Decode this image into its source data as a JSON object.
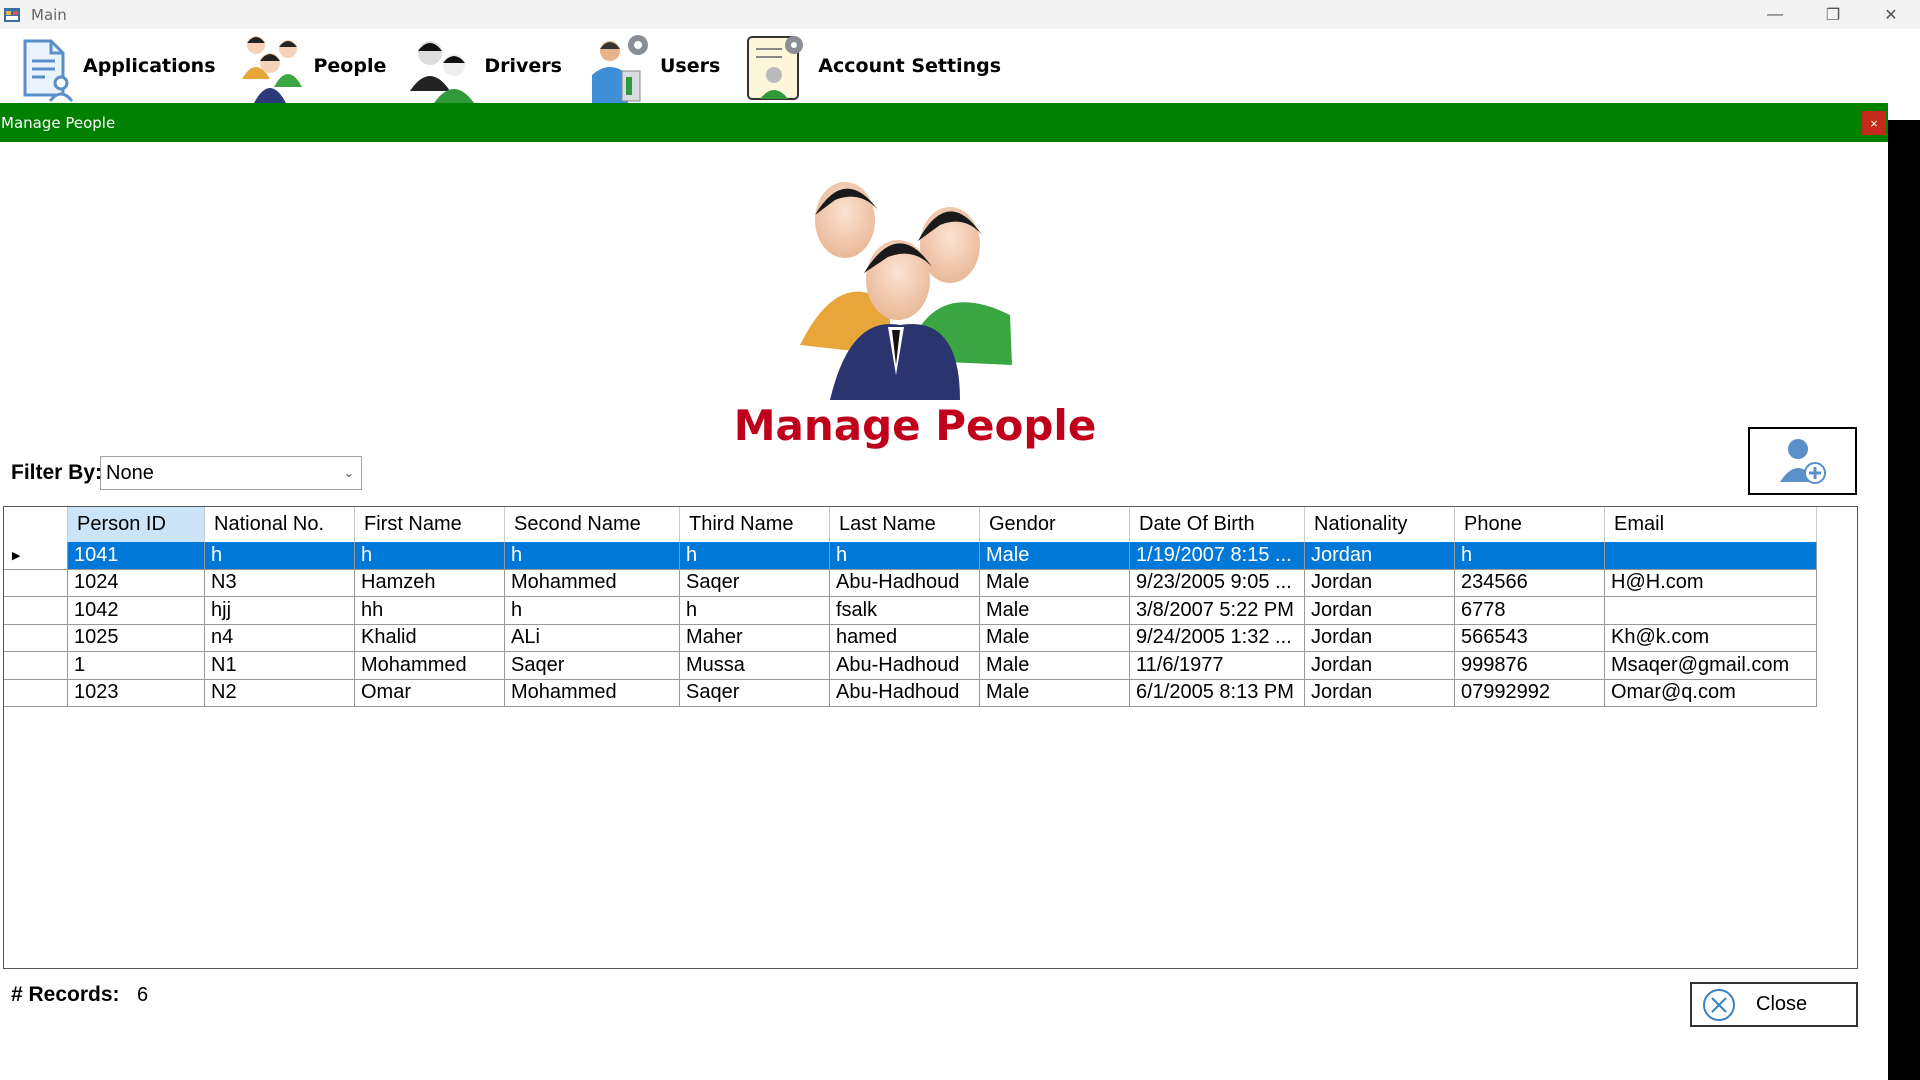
{
  "window": {
    "title": "Main",
    "controls": {
      "minimize": "—",
      "restore": "❐",
      "close": "✕"
    }
  },
  "menu": {
    "items": [
      {
        "label": "Applications",
        "icon": "document-user-icon"
      },
      {
        "label": "People",
        "icon": "people-icon"
      },
      {
        "label": "Drivers",
        "icon": "drivers-icon"
      },
      {
        "label": "Users",
        "icon": "user-gear-icon"
      },
      {
        "label": "Account Settings",
        "icon": "account-settings-icon"
      }
    ]
  },
  "child": {
    "title": "Manage People",
    "close_glyph": "×",
    "heading": "Manage People",
    "filter_label": "Filter By:",
    "filter_value": "None",
    "records_label": "# Records:",
    "records_count": "6",
    "close_button": "Close"
  },
  "colors": {
    "child_titlebar": "#008000",
    "heading": "#c0001a",
    "selection": "#0078d7",
    "header_active": "#cce4f7"
  },
  "grid": {
    "columns": [
      "Person ID",
      "National No.",
      "First Name",
      "Second Name",
      "Third Name",
      "Last Name",
      "Gendor",
      "Date Of Birth",
      "Nationality",
      "Phone",
      "Email"
    ],
    "selected_row": 0,
    "rows": [
      [
        "1041",
        "h",
        "h",
        "h",
        "h",
        "h",
        "Male",
        "1/19/2007 8:15 ...",
        "Jordan",
        "h",
        ""
      ],
      [
        "1024",
        "N3",
        "Hamzeh",
        "Mohammed",
        "Saqer",
        "Abu-Hadhoud",
        "Male",
        "9/23/2005 9:05 ...",
        "Jordan",
        "234566",
        "H@H.com"
      ],
      [
        "1042",
        "hjj",
        "hh",
        "h",
        "h",
        "fsalk",
        "Male",
        "3/8/2007 5:22 PM",
        "Jordan",
        "6778",
        ""
      ],
      [
        "1025",
        "n4",
        "Khalid",
        "ALi",
        "Maher",
        "hamed",
        "Male",
        "9/24/2005 1:32 ...",
        "Jordan",
        "566543",
        "Kh@k.com"
      ],
      [
        "1",
        "N1",
        "Mohammed",
        "Saqer",
        "Mussa",
        "Abu-Hadhoud",
        "Male",
        "11/6/1977",
        "Jordan",
        "999876",
        "Msaqer@gmail.com"
      ],
      [
        "1023",
        "N2",
        "Omar",
        "Mohammed",
        "Saqer",
        "Abu-Hadhoud",
        "Male",
        "6/1/2005 8:13 PM",
        "Jordan",
        "07992992",
        "Omar@q.com"
      ]
    ]
  }
}
